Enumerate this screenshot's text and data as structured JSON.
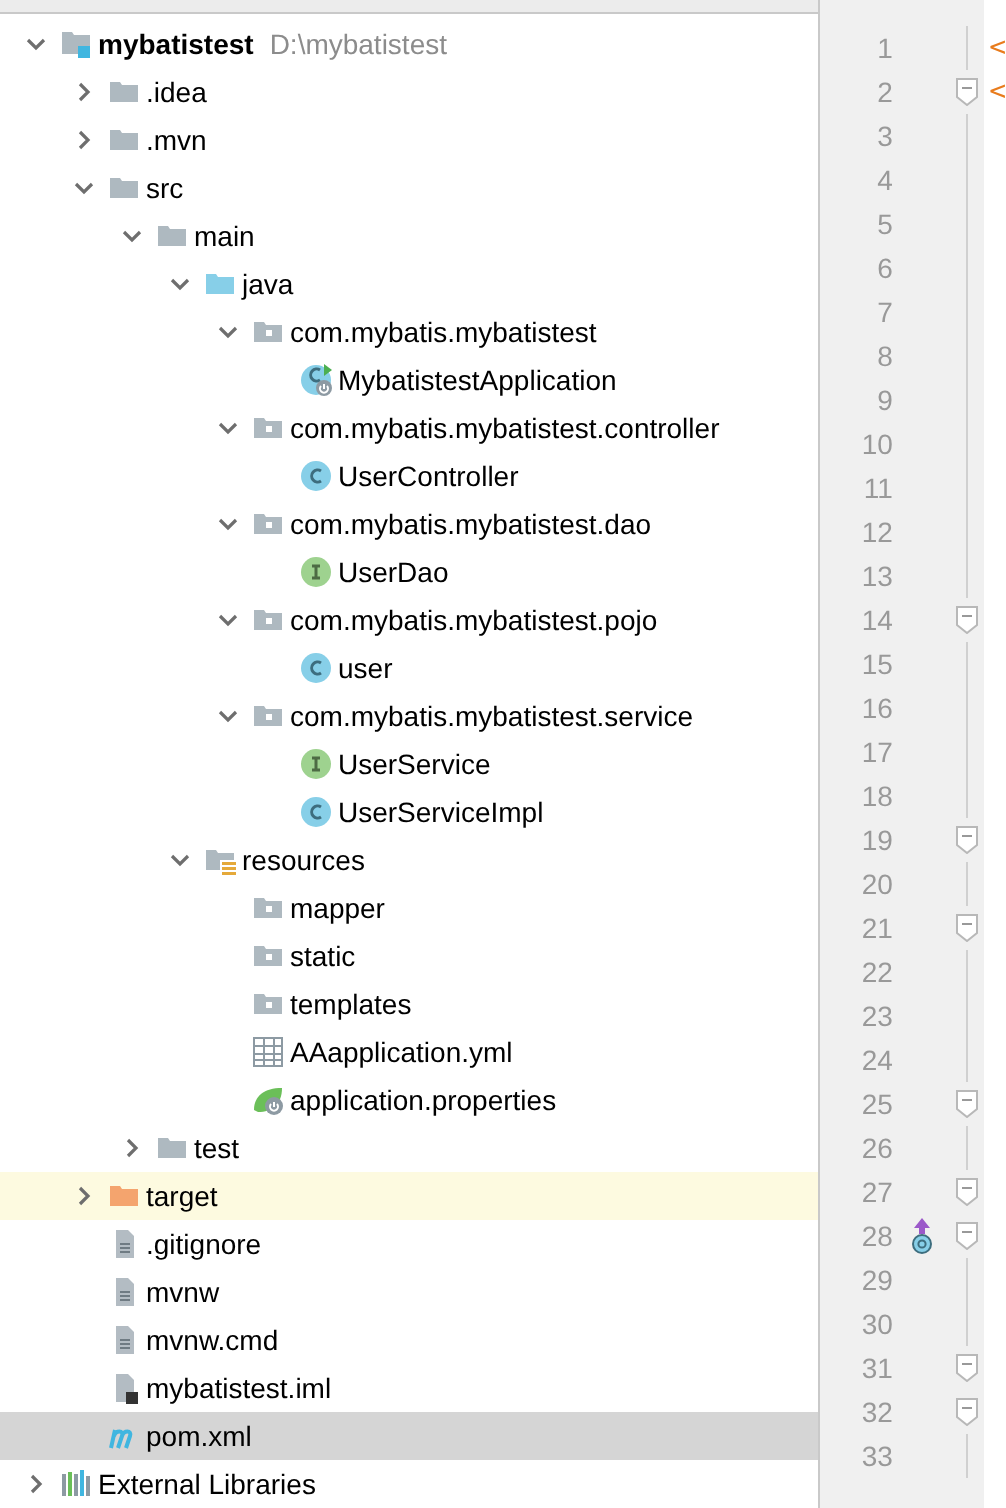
{
  "project_tree": [
    {
      "label": "mybatistest",
      "path": "D:\\mybatistest",
      "kind": "module",
      "expanded": true,
      "selected": false,
      "children": [
        {
          "label": ".idea",
          "kind": "folder",
          "expanded": false,
          "selected": false
        },
        {
          "label": ".mvn",
          "kind": "folder",
          "expanded": false,
          "selected": false
        },
        {
          "label": "src",
          "kind": "folder",
          "expanded": true,
          "selected": false,
          "children": [
            {
              "label": "main",
              "kind": "folder",
              "expanded": true,
              "selected": false,
              "children": [
                {
                  "label": "java",
                  "kind": "source_folder",
                  "expanded": true,
                  "selected": false,
                  "children": [
                    {
                      "label": "com.mybatis.mybatistest",
                      "kind": "package",
                      "expanded": true,
                      "selected": false,
                      "children": [
                        {
                          "label": "MybatistestApplication",
                          "kind": "spring_class",
                          "selected": false
                        }
                      ]
                    },
                    {
                      "label": "com.mybatis.mybatistest.controller",
                      "kind": "package",
                      "expanded": true,
                      "selected": false,
                      "children": [
                        {
                          "label": "UserController",
                          "kind": "class",
                          "selected": false
                        }
                      ]
                    },
                    {
                      "label": "com.mybatis.mybatistest.dao",
                      "kind": "package",
                      "expanded": true,
                      "selected": false,
                      "children": [
                        {
                          "label": "UserDao",
                          "kind": "interface",
                          "selected": false
                        }
                      ]
                    },
                    {
                      "label": "com.mybatis.mybatistest.pojo",
                      "kind": "package",
                      "expanded": true,
                      "selected": false,
                      "children": [
                        {
                          "label": "user",
                          "kind": "class",
                          "selected": false
                        }
                      ]
                    },
                    {
                      "label": "com.mybatis.mybatistest.service",
                      "kind": "package",
                      "expanded": true,
                      "selected": false,
                      "children": [
                        {
                          "label": "UserService",
                          "kind": "interface",
                          "selected": false
                        },
                        {
                          "label": "UserServiceImpl",
                          "kind": "class",
                          "selected": false
                        }
                      ]
                    }
                  ]
                },
                {
                  "label": "resources",
                  "kind": "resource_folder",
                  "expanded": true,
                  "selected": false,
                  "children": [
                    {
                      "label": "mapper",
                      "kind": "package",
                      "selected": false
                    },
                    {
                      "label": "static",
                      "kind": "package",
                      "selected": false
                    },
                    {
                      "label": "templates",
                      "kind": "package",
                      "selected": false
                    },
                    {
                      "label": "AAapplication.yml",
                      "kind": "yml",
                      "selected": false
                    },
                    {
                      "label": "application.properties",
                      "kind": "properties",
                      "selected": false
                    }
                  ]
                }
              ]
            },
            {
              "label": "test",
              "kind": "folder",
              "expanded": false,
              "selected": false
            }
          ]
        },
        {
          "label": "target",
          "kind": "excluded_folder",
          "expanded": false,
          "selected": false
        },
        {
          "label": ".gitignore",
          "kind": "file",
          "selected": false
        },
        {
          "label": "mvnw",
          "kind": "file",
          "selected": false
        },
        {
          "label": "mvnw.cmd",
          "kind": "file",
          "selected": false
        },
        {
          "label": "mybatistest.iml",
          "kind": "iml",
          "selected": false
        },
        {
          "label": "pom.xml",
          "kind": "maven",
          "selected": true
        }
      ]
    },
    {
      "label": "External Libraries",
      "kind": "libraries",
      "expanded": false,
      "selected": false
    }
  ],
  "gutter": [
    {
      "number": "1",
      "fold": false,
      "implemented": false,
      "code": "<"
    },
    {
      "number": "2",
      "fold": true,
      "implemented": false,
      "code": "<"
    },
    {
      "number": "3",
      "fold": false,
      "implemented": false
    },
    {
      "number": "4",
      "fold": false,
      "implemented": false
    },
    {
      "number": "5",
      "fold": false,
      "implemented": false
    },
    {
      "number": "6",
      "fold": false,
      "implemented": false
    },
    {
      "number": "7",
      "fold": false,
      "implemented": false
    },
    {
      "number": "8",
      "fold": false,
      "implemented": false
    },
    {
      "number": "9",
      "fold": false,
      "implemented": false
    },
    {
      "number": "10",
      "fold": false,
      "implemented": false
    },
    {
      "number": "11",
      "fold": false,
      "implemented": false
    },
    {
      "number": "12",
      "fold": false,
      "implemented": false
    },
    {
      "number": "13",
      "fold": false,
      "implemented": false
    },
    {
      "number": "14",
      "fold": true,
      "implemented": false
    },
    {
      "number": "15",
      "fold": false,
      "implemented": false
    },
    {
      "number": "16",
      "fold": false,
      "implemented": false
    },
    {
      "number": "17",
      "fold": false,
      "implemented": false
    },
    {
      "number": "18",
      "fold": false,
      "implemented": false
    },
    {
      "number": "19",
      "fold": true,
      "implemented": false
    },
    {
      "number": "20",
      "fold": false,
      "implemented": false
    },
    {
      "number": "21",
      "fold": true,
      "implemented": false
    },
    {
      "number": "22",
      "fold": false,
      "implemented": false
    },
    {
      "number": "23",
      "fold": false,
      "implemented": false
    },
    {
      "number": "24",
      "fold": false,
      "implemented": false
    },
    {
      "number": "25",
      "fold": true,
      "implemented": false
    },
    {
      "number": "26",
      "fold": false,
      "implemented": false
    },
    {
      "number": "27",
      "fold": true,
      "implemented": false
    },
    {
      "number": "28",
      "fold": true,
      "implemented": true
    },
    {
      "number": "29",
      "fold": false,
      "implemented": false
    },
    {
      "number": "30",
      "fold": false,
      "implemented": false
    },
    {
      "number": "31",
      "fold": true,
      "implemented": false
    },
    {
      "number": "32",
      "fold": true,
      "implemented": false
    },
    {
      "number": "33",
      "fold": false,
      "implemented": false
    }
  ]
}
